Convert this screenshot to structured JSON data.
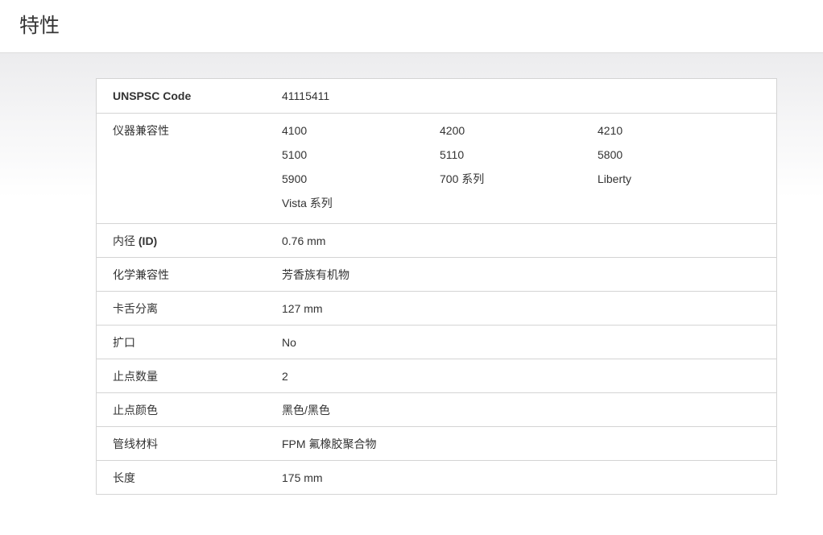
{
  "page": {
    "title": "特性"
  },
  "specs": {
    "unspsc": {
      "label": "UNSPSC Code",
      "value": "41115411"
    },
    "compat": {
      "label": "仪器兼容性",
      "items": [
        "4100",
        "4200",
        "4210",
        "5100",
        "5110",
        "5800",
        "5900",
        "700 系列",
        "Liberty",
        "Vista 系列"
      ]
    },
    "inner_diameter": {
      "label_prefix": "内径 ",
      "label_bold": "(ID)",
      "value": "0.76 mm"
    },
    "chem_compat": {
      "label": "化学兼容性",
      "value": "芳香族有机物"
    },
    "clip_separation": {
      "label": "卡舌分离",
      "value": "127 mm"
    },
    "flare": {
      "label": "扩口",
      "value": "No"
    },
    "stop_count": {
      "label": "止点数量",
      "value": "2"
    },
    "stop_color": {
      "label": "止点颜色",
      "value": "黑色/黑色"
    },
    "tubing_material": {
      "label": "管线材料",
      "value": "FPM 氟橡胶聚合物"
    },
    "length": {
      "label": "长度",
      "value": "175 mm"
    }
  }
}
